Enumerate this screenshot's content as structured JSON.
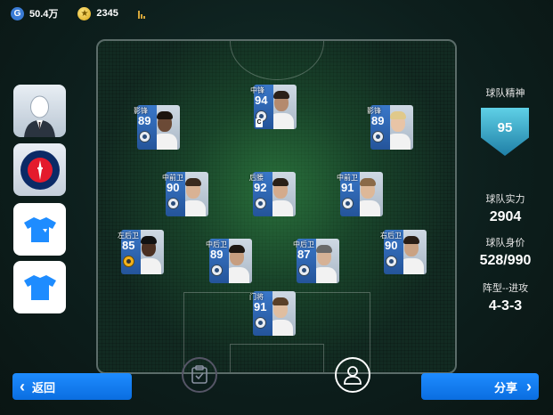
{
  "currency": {
    "gp": {
      "icon": "g-coin-icon",
      "value": "50.4万"
    },
    "coins": {
      "icon": "gold-star-coin-icon",
      "value": "2345"
    }
  },
  "team": {
    "spirit_label": "球队精神",
    "spirit_value": "95",
    "strength_label": "球队实力",
    "strength_value": "2904",
    "value_label": "球队身价",
    "value_value": "528/990",
    "formation_label": "阵型--进攻",
    "formation_value": "4-3-3"
  },
  "players": [
    {
      "pos": "中锋",
      "rating": "94",
      "hair": "#2a1f18",
      "skin": "#b48a6e",
      "captain": true,
      "badge": "blue"
    },
    {
      "pos": "影锋",
      "rating": "89",
      "hair": "#1c140f",
      "skin": "#6b4a36",
      "captain": false,
      "badge": "blue"
    },
    {
      "pos": "影锋",
      "rating": "89",
      "hair": "#e0c98a",
      "skin": "#e8c4a6",
      "captain": false,
      "badge": "blue"
    },
    {
      "pos": "中前卫",
      "rating": "90",
      "hair": "#3a2a1e",
      "skin": "#d9b294",
      "captain": false,
      "badge": "blue"
    },
    {
      "pos": "后腰",
      "rating": "92",
      "hair": "#2a2018",
      "skin": "#d4ab8c",
      "captain": false,
      "badge": "blue"
    },
    {
      "pos": "中前卫",
      "rating": "91",
      "hair": "#8a6a48",
      "skin": "#ddb898",
      "captain": false,
      "badge": "blue"
    },
    {
      "pos": "左后卫",
      "rating": "85",
      "hair": "#111",
      "skin": "#4b3022",
      "captain": false,
      "badge": "yellow"
    },
    {
      "pos": "中后卫",
      "rating": "89",
      "hair": "#1e1712",
      "skin": "#c79e80",
      "captain": false,
      "badge": "blue"
    },
    {
      "pos": "中后卫",
      "rating": "87",
      "hair": "#6a6a6a",
      "skin": "#d6b296",
      "captain": false,
      "badge": "blue"
    },
    {
      "pos": "右后卫",
      "rating": "90",
      "hair": "#2a1e16",
      "skin": "#caa283",
      "captain": false,
      "badge": "blue"
    },
    {
      "pos": "门将",
      "rating": "91",
      "hair": "#5a4028",
      "skin": "#e0bea0",
      "captain": false,
      "badge": "blue"
    }
  ],
  "captain_mark": "C",
  "buttons": {
    "back_label": "返回",
    "share_label": "分享"
  },
  "icons": {
    "chart": "bar-chart-icon",
    "back": "chevron-left-icon",
    "share": "chevron-right-icon",
    "save": "save-clipboard-icon",
    "person": "person-icon"
  },
  "colors": {
    "accent_blue": "#1e8cff",
    "card_blue": "#2f67b3",
    "gold": "#f2b21c"
  }
}
